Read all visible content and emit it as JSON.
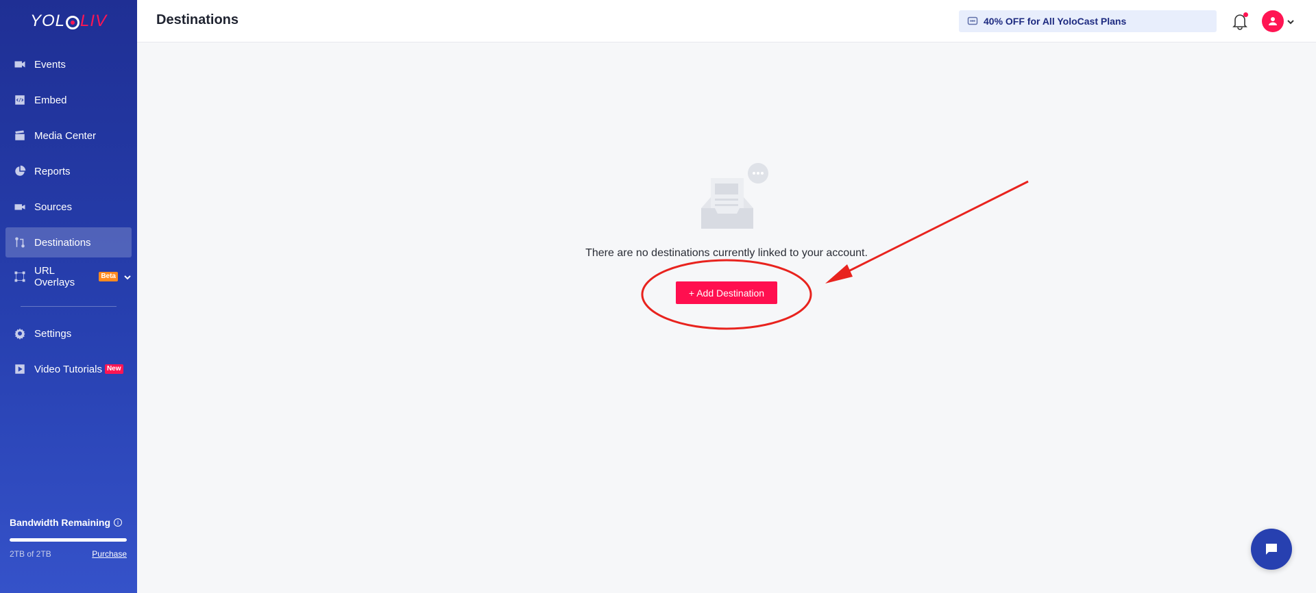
{
  "brand": {
    "logo_left": "YOL",
    "logo_right": "LIV",
    "accent": "#ff1553",
    "sidebar_color": "#2740b0"
  },
  "sidebar": {
    "items": [
      {
        "label": "Events",
        "icon": "video-camera-icon"
      },
      {
        "label": "Embed",
        "icon": "code-icon"
      },
      {
        "label": "Media Center",
        "icon": "clapperboard-icon"
      },
      {
        "label": "Reports",
        "icon": "pie-chart-icon"
      },
      {
        "label": "Sources",
        "icon": "camera-icon"
      },
      {
        "label": "Destinations",
        "icon": "route-icon",
        "active": true
      },
      {
        "label": "URL Overlays",
        "icon": "overlay-icon",
        "badge": "Beta"
      },
      {
        "label": "Settings",
        "icon": "gear-icon"
      },
      {
        "label": "Video Tutorials",
        "icon": "play-icon",
        "badge": "New"
      }
    ],
    "bandwidth": {
      "title": "Bandwidth Remaining",
      "used_text": "2TB of 2TB",
      "fraction_remaining": 1.0,
      "purchase_label": "Purchase"
    }
  },
  "header": {
    "title": "Destinations",
    "promo_text": "40% OFF for All YoloCast Plans"
  },
  "main": {
    "empty_message": "There are no destinations currently linked to your account.",
    "add_button_label": "+ Add Destination"
  }
}
